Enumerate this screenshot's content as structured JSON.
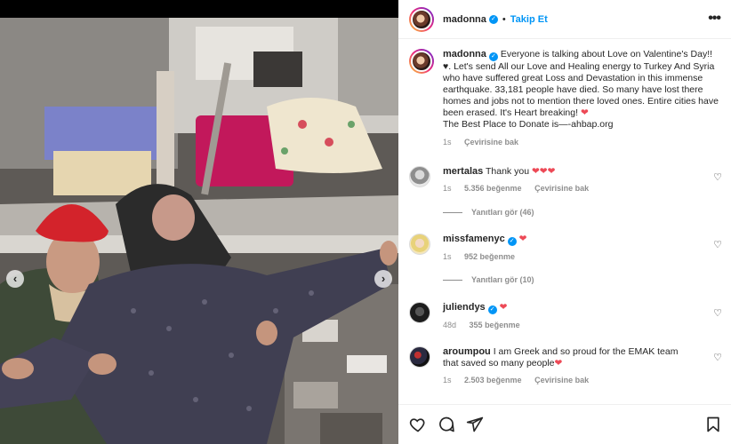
{
  "colors": {
    "accent": "#0095f6",
    "heart": "#ed4956",
    "muted": "#8e8e8e"
  },
  "header": {
    "username": "madonna",
    "separator": "•",
    "follow_label": "Takip Et",
    "more_icon": "more-horizontal-icon"
  },
  "caption": {
    "username": "madonna",
    "text": "Everyone is talking about Love  on Valentine's Day!! ♥. Let's send All our Love and Healing  energy to Turkey And Syria who have suffered great Loss and Devastation in this immense earthquake.  33,181 people have died.  So many  have lost there homes and jobs not to mention there loved ones. Entire cities have been erased. It's Heart breaking! ❤",
    "text_line2": "The Best Place to Donate is—-ahbap.org",
    "age": "1s",
    "translate": "Çevirisine bak"
  },
  "comments": [
    {
      "username": "mertalas",
      "text": "Thank you ❤❤❤",
      "age": "1s",
      "likes": "5.356 beğenme",
      "translate": "Çevirisine bak",
      "replies": "Yanıtları gör (46)"
    },
    {
      "username": "missfamenyc",
      "verified": true,
      "text": "❤",
      "age": "1s",
      "likes": "952 beğenme",
      "translate": "",
      "replies": "Yanıtları gör (10)"
    },
    {
      "username": "juliendys",
      "verified": true,
      "text": "❤",
      "age": "48d",
      "likes": "355 beğenme",
      "translate": "",
      "replies": ""
    },
    {
      "username": "aroumpou",
      "text": "I am Greek and so proud for the EMAK team that saved so many people❤",
      "age": "1s",
      "likes": "2.503 beğenme",
      "translate": "Çevirisine bak",
      "replies": ""
    }
  ],
  "actions": {
    "like": "heart-icon",
    "comment": "comment-icon",
    "share": "share-icon",
    "save": "bookmark-icon"
  },
  "carousel": {
    "prev": "‹",
    "next": "›"
  }
}
